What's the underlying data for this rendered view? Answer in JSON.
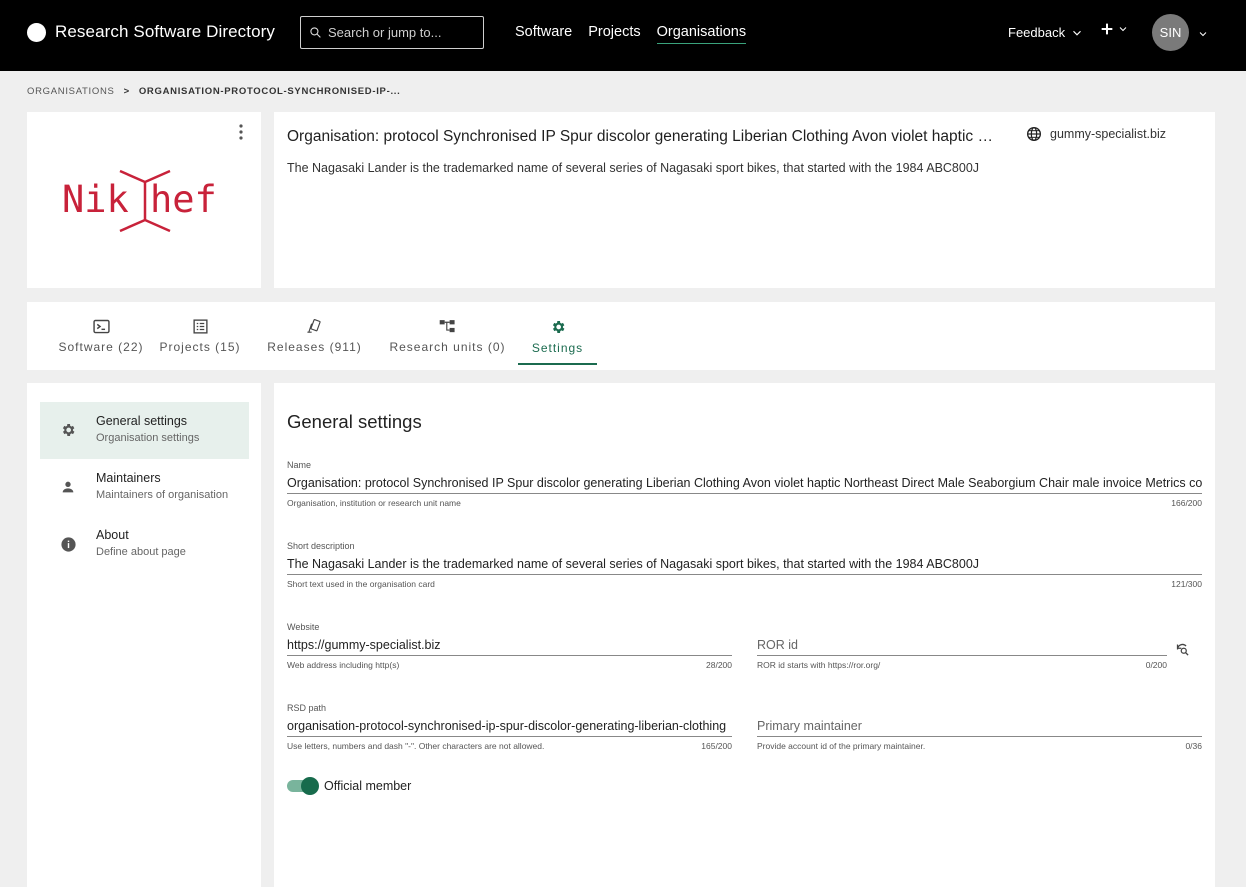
{
  "header": {
    "brand": "Research Software Directory",
    "search_placeholder": "Search or jump to...",
    "nav": [
      "Software",
      "Projects",
      "Organisations"
    ],
    "feedback_label": "Feedback",
    "avatar_initials": "SIN"
  },
  "breadcrumb": {
    "root": "ORGANISATIONS",
    "current": "ORGANISATION-PROTOCOL-SYNCHRONISED-IP-..."
  },
  "logo_text": "Nikhef",
  "org": {
    "title": "Organisation: protocol Synchronised IP Spur discolor generating Liberian Clothing Avon violet haptic Northeast Direct Male Seaborgium Chair male invoice Metrics convergence",
    "description": "The Nagasaki Lander is the trademarked name of several series of Nagasaki sport bikes, that started with the 1984 ABC800J",
    "website": "gummy-specialist.biz"
  },
  "tabs": [
    {
      "label": "Software (22)",
      "icon": "terminal-icon"
    },
    {
      "label": "Projects (15)",
      "icon": "list-icon"
    },
    {
      "label": "Releases (911)",
      "icon": "releases-icon"
    },
    {
      "label": "Research units (0)",
      "icon": "hierarchy-icon"
    },
    {
      "label": "Settings",
      "icon": "gear-icon"
    }
  ],
  "sidebar": {
    "items": [
      {
        "title": "General settings",
        "subtitle": "Organisation settings",
        "icon": "gear-icon"
      },
      {
        "title": "Maintainers",
        "subtitle": "Maintainers of organisation",
        "icon": "person-icon"
      },
      {
        "title": "About",
        "subtitle": "Define about page",
        "icon": "info-icon"
      }
    ]
  },
  "settings": {
    "title": "General settings",
    "name": {
      "label": "Name",
      "value": "Organisation: protocol Synchronised IP Spur discolor generating Liberian Clothing Avon violet haptic Northeast Direct Male Seaborgium Chair male invoice Metrics convergence",
      "help": "Organisation, institution or research unit name",
      "count": "166/200"
    },
    "short_description": {
      "label": "Short description",
      "value": "The Nagasaki Lander is the trademarked name of several series of Nagasaki sport bikes, that started with the 1984 ABC800J",
      "help": "Short text used in the organisation card",
      "count": "121/300"
    },
    "website": {
      "label": "Website",
      "value": "https://gummy-specialist.biz",
      "help": "Web address including http(s)",
      "count": "28/200"
    },
    "ror": {
      "placeholder": "ROR id",
      "help": "ROR id starts with https://ror.org/",
      "count": "0/200"
    },
    "rsd_path": {
      "label": "RSD path",
      "value": "organisation-protocol-synchronised-ip-spur-discolor-generating-liberian-clothing",
      "help": "Use letters, numbers and dash \"-\". Other characters are not allowed.",
      "count": "165/200"
    },
    "primary_maintainer": {
      "placeholder": "Primary maintainer",
      "help": "Provide account id of the primary maintainer.",
      "count": "0/36"
    },
    "official_member": {
      "label": "Official member",
      "checked": true
    }
  },
  "colors": {
    "accent": "#1b6b4f",
    "header_bg": "#000000",
    "logo": "#c8223a"
  }
}
